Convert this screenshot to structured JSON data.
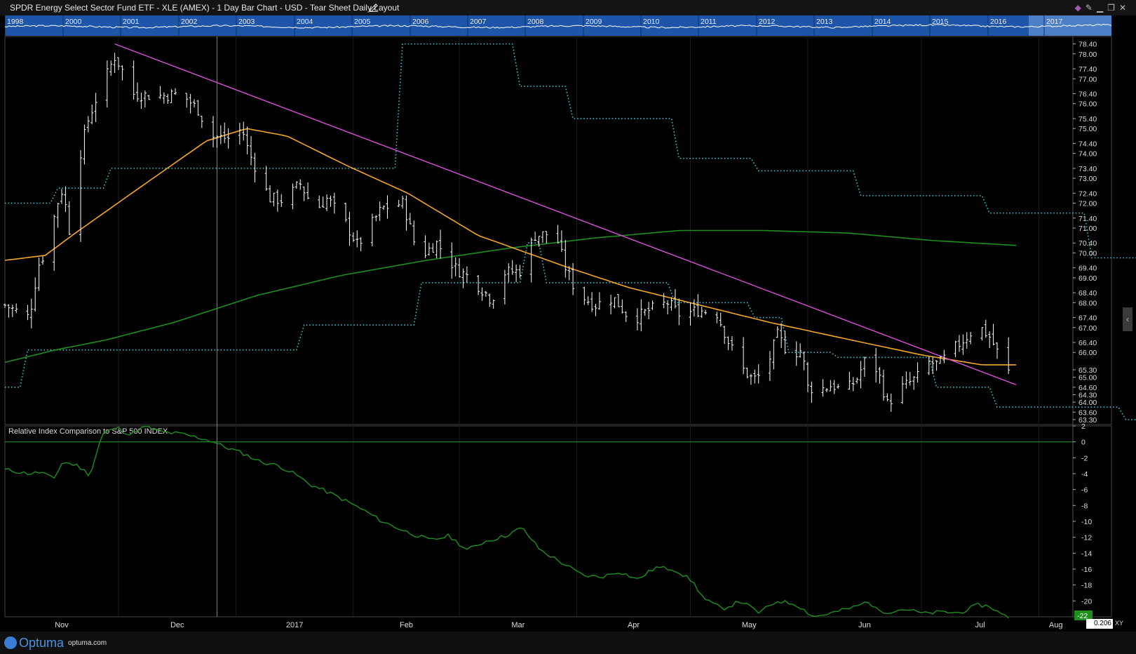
{
  "window": {
    "title": "SPDR Energy Select Sector Fund ETF - XLE (AMEX) - 1 Day Bar Chart - USD - Tear Sheet Daily Layout",
    "icons": [
      "diamond-icon",
      "pin-icon",
      "minimize-icon",
      "restore-icon",
      "close-icon"
    ]
  },
  "overview": {
    "years": [
      "1998",
      "2000",
      "2001",
      "2002",
      "2003",
      "2004",
      "2005",
      "2006",
      "2007",
      "2008",
      "2009",
      "2010",
      "2011",
      "2012",
      "2013",
      "2014",
      "2015",
      "2016",
      "2017"
    ],
    "selected": "2017"
  },
  "chart_data": [
    {
      "type": "bar",
      "title": "",
      "x_range": [
        "2016-11-01",
        "2017-08-10"
      ],
      "months": [
        "Nov",
        "Dec",
        "2017",
        "Feb",
        "Mar",
        "Apr",
        "May",
        "Jun",
        "Jul",
        "Aug"
      ],
      "ylim": [
        63.1,
        78.7
      ],
      "y_ticks": [
        "78.40",
        "78.00",
        "77.40",
        "77.00",
        "76.40",
        "76.00",
        "75.40",
        "75.00",
        "74.40",
        "74.00",
        "73.40",
        "73.00",
        "72.40",
        "72.00",
        "71.40",
        "71.00",
        "70.40",
        "70.00",
        "69.40",
        "69.00",
        "68.40",
        "68.00",
        "67.40",
        "67.00",
        "66.40",
        "66.00",
        "65.30",
        "65.00",
        "64.60",
        "64.30",
        "64.00",
        "63.60",
        "63.30"
      ],
      "price_series": {
        "name": "",
        "start": "2016-11-01",
        "end": "2017-07-24",
        "anchors": [
          [
            0,
            67.9
          ],
          [
            8,
            67.4
          ],
          [
            11,
            69.5
          ],
          [
            14,
            70.2
          ],
          [
            17,
            71.9
          ],
          [
            19,
            72.6
          ],
          [
            22,
            70.3
          ],
          [
            23,
            73.0
          ],
          [
            27,
            75.2
          ],
          [
            30,
            76.2
          ],
          [
            32,
            76.7
          ],
          [
            36,
            77.9
          ],
          [
            38,
            77.5
          ],
          [
            42,
            76.4
          ],
          [
            50,
            76.3
          ],
          [
            58,
            76.4
          ],
          [
            64,
            75.7
          ],
          [
            67,
            74.7
          ],
          [
            74,
            74.6
          ],
          [
            78,
            75.0
          ],
          [
            80,
            74.1
          ],
          [
            87,
            72.2
          ],
          [
            92,
            72.1
          ],
          [
            97,
            72.8
          ],
          [
            102,
            71.7
          ],
          [
            106,
            72.2
          ],
          [
            112,
            71.2
          ],
          [
            116,
            70.3
          ],
          [
            124,
            71.8
          ],
          [
            131,
            72.0
          ],
          [
            136,
            69.8
          ],
          [
            142,
            70.4
          ],
          [
            148,
            69.4
          ],
          [
            154,
            68.9
          ],
          [
            158,
            68.4
          ],
          [
            160,
            68.1
          ],
          [
            164,
            69.2
          ],
          [
            170,
            69.3
          ],
          [
            174,
            70.7
          ],
          [
            181,
            70.8
          ],
          [
            184,
            69.5
          ],
          [
            188,
            68.4
          ],
          [
            194,
            67.9
          ],
          [
            200,
            68.2
          ],
          [
            206,
            67.3
          ],
          [
            212,
            67.7
          ],
          [
            218,
            68.0
          ],
          [
            222,
            67.5
          ],
          [
            228,
            67.7
          ],
          [
            234,
            67.6
          ],
          [
            238,
            66.4
          ],
          [
            242,
            65.4
          ],
          [
            246,
            64.9
          ],
          [
            250,
            65.2
          ],
          [
            254,
            66.7
          ],
          [
            258,
            65.9
          ],
          [
            262,
            66.1
          ],
          [
            264,
            64.6
          ],
          [
            268,
            64.5
          ],
          [
            272,
            64.7
          ],
          [
            276,
            64.4
          ],
          [
            280,
            64.9
          ],
          [
            284,
            66.0
          ],
          [
            288,
            64.9
          ],
          [
            290,
            63.9
          ],
          [
            294,
            64.5
          ],
          [
            300,
            65.0
          ],
          [
            304,
            65.6
          ],
          [
            307,
            65.5
          ],
          [
            310,
            65.9
          ],
          [
            316,
            66.6
          ],
          [
            320,
            67.1
          ],
          [
            324,
            66.6
          ],
          [
            328,
            65.6
          ],
          [
            330,
            65.2
          ]
        ]
      },
      "donchian_upper": {
        "name": "",
        "step_days": [
          0,
          14,
          28,
          105,
          120,
          136,
          150,
          178,
          199,
          226,
          260,
          287,
          313,
          332
        ],
        "values": [
          72.0,
          72.6,
          73.4,
          78.4,
          78.4,
          76.7,
          75.4,
          73.8,
          73.3,
          72.3,
          71.6,
          69.8,
          68.8,
          68.8
        ]
      },
      "donchian_lower": {
        "name": "",
        "step_days": [
          0,
          6,
          65,
          79,
          110,
          138,
          143,
          177,
          198,
          207,
          220,
          246,
          262,
          296,
          332
        ],
        "values": [
          64.6,
          66.1,
          66.1,
          67.1,
          68.8,
          70.4,
          68.8,
          68.0,
          67.4,
          66.0,
          65.8,
          64.6,
          63.8,
          63.3,
          63.3
        ]
      },
      "ma_orange": {
        "name": "",
        "anchors": [
          [
            0,
            69.7
          ],
          [
            20,
            69.9
          ],
          [
            35,
            70.8
          ],
          [
            70,
            72.8
          ],
          [
            100,
            74.5
          ],
          [
            120,
            75.0
          ],
          [
            140,
            74.7
          ],
          [
            170,
            73.5
          ],
          [
            200,
            72.4
          ],
          [
            235,
            70.7
          ],
          [
            280,
            69.4
          ],
          [
            310,
            68.6
          ],
          [
            340,
            68.0
          ],
          [
            380,
            67.2
          ],
          [
            420,
            66.5
          ],
          [
            455,
            65.9
          ],
          [
            485,
            65.5
          ],
          [
            502,
            65.5
          ]
        ]
      },
      "ma_green": {
        "name": "",
        "anchors": [
          [
            0,
            65.6
          ],
          [
            30,
            66.1
          ],
          [
            60,
            66.5
          ],
          [
            100,
            67.2
          ],
          [
            150,
            68.3
          ],
          [
            200,
            69.1
          ],
          [
            250,
            69.7
          ],
          [
            300,
            70.2
          ],
          [
            350,
            70.6
          ],
          [
            400,
            70.9
          ],
          [
            450,
            70.9
          ],
          [
            500,
            70.8
          ],
          [
            550,
            70.5
          ],
          [
            600,
            70.3
          ]
        ]
      },
      "trendline": {
        "name": "",
        "start": [
          "2016-11-30",
          78.4
        ],
        "end": [
          "2017-07-26",
          64.7
        ]
      }
    },
    {
      "type": "line",
      "title": "Relative Index Comparison to S&P 500 INDEX",
      "ylim": [
        -22,
        2
      ],
      "y_ticks": [
        "2",
        "0",
        "-2",
        "-4",
        "-6",
        "-8",
        "-10",
        "-12",
        "-14",
        "-16",
        "-18",
        "-20"
      ],
      "last_value_label": "-22",
      "series": {
        "name": "",
        "anchors": [
          [
            0,
            -3.5
          ],
          [
            8,
            -4.0
          ],
          [
            12,
            -3.8
          ],
          [
            16,
            -4.7
          ],
          [
            19,
            -2.5
          ],
          [
            24,
            -3.0
          ],
          [
            28,
            -4.2
          ],
          [
            32,
            1.0
          ],
          [
            37,
            1.8
          ],
          [
            41,
            0.9
          ],
          [
            46,
            1.9
          ],
          [
            52,
            1.2
          ],
          [
            58,
            1.0
          ],
          [
            64,
            0.5
          ],
          [
            68,
            0.1
          ],
          [
            72,
            -0.6
          ],
          [
            78,
            -1.4
          ],
          [
            84,
            -2.5
          ],
          [
            90,
            -3.0
          ],
          [
            96,
            -4.2
          ],
          [
            100,
            -5.3
          ],
          [
            106,
            -6.3
          ],
          [
            112,
            -7.4
          ],
          [
            118,
            -8.6
          ],
          [
            124,
            -10.0
          ],
          [
            132,
            -11.3
          ],
          [
            140,
            -12.4
          ],
          [
            146,
            -11.8
          ],
          [
            152,
            -13.6
          ],
          [
            158,
            -12.5
          ],
          [
            164,
            -11.9
          ],
          [
            170,
            -10.8
          ],
          [
            176,
            -13.6
          ],
          [
            184,
            -15.4
          ],
          [
            190,
            -16.8
          ],
          [
            196,
            -17.0
          ],
          [
            202,
            -16.3
          ],
          [
            208,
            -17.3
          ],
          [
            214,
            -15.8
          ],
          [
            220,
            -16.0
          ],
          [
            226,
            -17.5
          ],
          [
            230,
            -19.8
          ],
          [
            236,
            -21.0
          ],
          [
            242,
            -20.0
          ],
          [
            248,
            -21.5
          ],
          [
            254,
            -20.0
          ],
          [
            260,
            -20.4
          ],
          [
            266,
            -22.0
          ],
          [
            272,
            -21.5
          ],
          [
            280,
            -20.7
          ],
          [
            284,
            -20.0
          ],
          [
            286,
            -21.0
          ],
          [
            290,
            -21.4
          ],
          [
            296,
            -21.0
          ],
          [
            302,
            -21.6
          ],
          [
            308,
            -21.4
          ],
          [
            314,
            -21.5
          ],
          [
            320,
            -20.5
          ],
          [
            324,
            -20.7
          ],
          [
            328,
            -21.8
          ],
          [
            330,
            -22.0
          ]
        ]
      }
    }
  ],
  "footer": {
    "brand": "Optuma",
    "site": "optuma.com",
    "zoom": "0.206",
    "xy": "XY"
  },
  "colors": {
    "background": "#000000",
    "price_bars": "#ffffff",
    "donchian": "#3fc6d6",
    "ma_short": "#f5a623",
    "ma_long": "#1e8f1e",
    "trendline": "#d94fd9",
    "relative_line": "#1e8f1e",
    "overview_band": "#1e55a8",
    "last_value_bg": "#1e8f1e"
  }
}
